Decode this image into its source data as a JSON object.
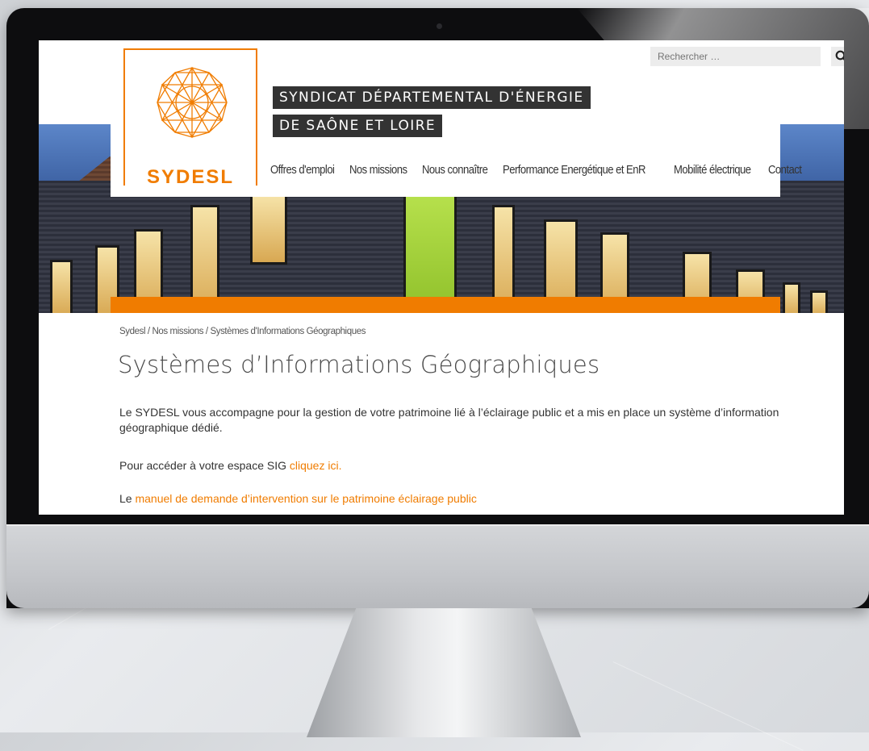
{
  "search": {
    "placeholder": "Rechercher …"
  },
  "logo": {
    "text": "SYDESL"
  },
  "title": {
    "line1": "SYNDICAT DÉPARTEMENTAL D'ÉNERGIE",
    "line2": "DE SAÔNE ET LOIRE"
  },
  "nav": {
    "items": [
      "Offres d'emploi",
      "Nos missions",
      "Nous connaître",
      "Performance Energétique et EnR",
      "Mobilité électrique",
      "Contact"
    ]
  },
  "breadcrumb": "Sydesl / Nos missions / Systèmes d'Informations Géographiques",
  "page": {
    "title": "Systèmes d’Informations Géographiques",
    "p1": "Le SYDESL vous accompagne pour la gestion de votre patrimoine lié à l’éclairage public et a mis en place un système d’information géographique dédié.",
    "p2_text": "Pour accéder à votre espace SIG ",
    "p2_link": "cliquez ici.",
    "p3_text": "Le ",
    "p3_link": "manuel de demande d’intervention sur le patrimoine éclairage public"
  },
  "colors": {
    "accent": "#f07c00",
    "title_bg": "#333333"
  }
}
